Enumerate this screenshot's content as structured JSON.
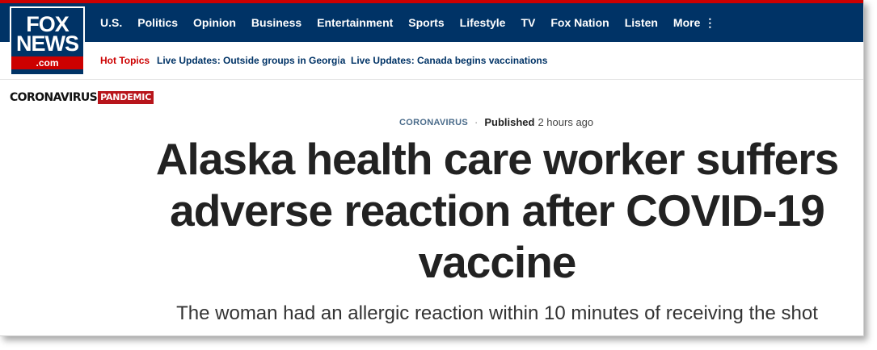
{
  "logo": {
    "line1": "FOX",
    "line2": "NEWS",
    "dotcom": ".com"
  },
  "nav": {
    "items": [
      "U.S.",
      "Politics",
      "Opinion",
      "Business",
      "Entertainment",
      "Sports",
      "Lifestyle",
      "TV",
      "Fox Nation",
      "Listen"
    ],
    "more_label": "More",
    "more_icon": "⋮"
  },
  "subbar": {
    "hot_topics_label": "Hot Topics",
    "updates": [
      "Live Updates: Outside groups in Georgia",
      "Live Updates: Canada begins vaccinations"
    ],
    "separator": "|"
  },
  "banner": {
    "word": "CORONAVIRUS",
    "tag": "PANDEMIC"
  },
  "article": {
    "category": "CORONAVIRUS",
    "published_label": "Published",
    "published_time": "2 hours ago",
    "headline": "Alaska health care worker suffers adverse reaction after COVID-19 vaccine",
    "subhead": "The woman had an allergic reaction within 10 minutes of receiving the shot"
  },
  "colors": {
    "nav_bg": "#003366",
    "accent_red": "#cc0000",
    "link_blue": "#003366"
  }
}
